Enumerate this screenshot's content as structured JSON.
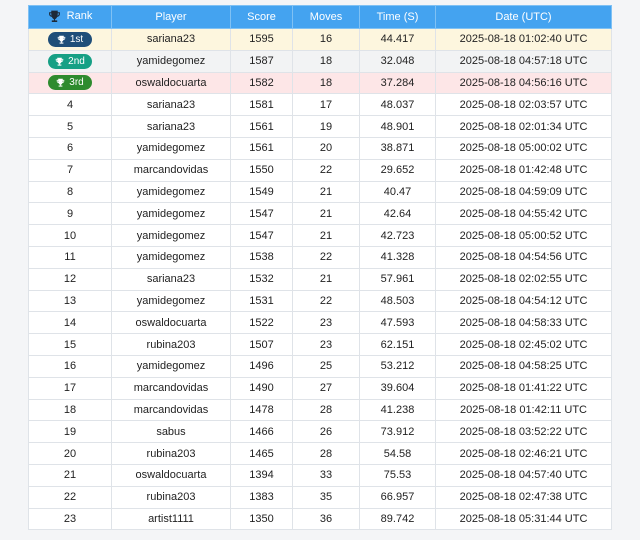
{
  "columns": {
    "rank": "Rank",
    "player": "Player",
    "score": "Score",
    "moves": "Moves",
    "time": "Time (S)",
    "date": "Date (UTC)"
  },
  "colors": {
    "header": "#44a3f0",
    "gold_badge": "#1f4e79",
    "silver_badge": "#16a085",
    "bronze_badge": "#2e8b2e"
  },
  "rows": [
    {
      "rank": "1st",
      "player": "sariana23",
      "score": "1595",
      "moves": "16",
      "time": "44.417",
      "date": "2025-08-18 01:02:40 UTC",
      "medal": "gold"
    },
    {
      "rank": "2nd",
      "player": "yamidegomez",
      "score": "1587",
      "moves": "18",
      "time": "32.048",
      "date": "2025-08-18 04:57:18 UTC",
      "medal": "silver"
    },
    {
      "rank": "3rd",
      "player": "oswaldocuarta",
      "score": "1582",
      "moves": "18",
      "time": "37.284",
      "date": "2025-08-18 04:56:16 UTC",
      "medal": "bronze"
    },
    {
      "rank": "4",
      "player": "sariana23",
      "score": "1581",
      "moves": "17",
      "time": "48.037",
      "date": "2025-08-18 02:03:57 UTC"
    },
    {
      "rank": "5",
      "player": "sariana23",
      "score": "1561",
      "moves": "19",
      "time": "48.901",
      "date": "2025-08-18 02:01:34 UTC"
    },
    {
      "rank": "6",
      "player": "yamidegomez",
      "score": "1561",
      "moves": "20",
      "time": "38.871",
      "date": "2025-08-18 05:00:02 UTC"
    },
    {
      "rank": "7",
      "player": "marcandovidas",
      "score": "1550",
      "moves": "22",
      "time": "29.652",
      "date": "2025-08-18 01:42:48 UTC"
    },
    {
      "rank": "8",
      "player": "yamidegomez",
      "score": "1549",
      "moves": "21",
      "time": "40.47",
      "date": "2025-08-18 04:59:09 UTC"
    },
    {
      "rank": "9",
      "player": "yamidegomez",
      "score": "1547",
      "moves": "21",
      "time": "42.64",
      "date": "2025-08-18 04:55:42 UTC"
    },
    {
      "rank": "10",
      "player": "yamidegomez",
      "score": "1547",
      "moves": "21",
      "time": "42.723",
      "date": "2025-08-18 05:00:52 UTC"
    },
    {
      "rank": "11",
      "player": "yamidegomez",
      "score": "1538",
      "moves": "22",
      "time": "41.328",
      "date": "2025-08-18 04:54:56 UTC"
    },
    {
      "rank": "12",
      "player": "sariana23",
      "score": "1532",
      "moves": "21",
      "time": "57.961",
      "date": "2025-08-18 02:02:55 UTC"
    },
    {
      "rank": "13",
      "player": "yamidegomez",
      "score": "1531",
      "moves": "22",
      "time": "48.503",
      "date": "2025-08-18 04:54:12 UTC"
    },
    {
      "rank": "14",
      "player": "oswaldocuarta",
      "score": "1522",
      "moves": "23",
      "time": "47.593",
      "date": "2025-08-18 04:58:33 UTC"
    },
    {
      "rank": "15",
      "player": "rubina203",
      "score": "1507",
      "moves": "23",
      "time": "62.151",
      "date": "2025-08-18 02:45:02 UTC"
    },
    {
      "rank": "16",
      "player": "yamidegomez",
      "score": "1496",
      "moves": "25",
      "time": "53.212",
      "date": "2025-08-18 04:58:25 UTC"
    },
    {
      "rank": "17",
      "player": "marcandovidas",
      "score": "1490",
      "moves": "27",
      "time": "39.604",
      "date": "2025-08-18 01:41:22 UTC"
    },
    {
      "rank": "18",
      "player": "marcandovidas",
      "score": "1478",
      "moves": "28",
      "time": "41.238",
      "date": "2025-08-18 01:42:11 UTC"
    },
    {
      "rank": "19",
      "player": "sabus",
      "score": "1466",
      "moves": "26",
      "time": "73.912",
      "date": "2025-08-18 03:52:22 UTC"
    },
    {
      "rank": "20",
      "player": "rubina203",
      "score": "1465",
      "moves": "28",
      "time": "54.58",
      "date": "2025-08-18 02:46:21 UTC"
    },
    {
      "rank": "21",
      "player": "oswaldocuarta",
      "score": "1394",
      "moves": "33",
      "time": "75.53",
      "date": "2025-08-18 04:57:40 UTC"
    },
    {
      "rank": "22",
      "player": "rubina203",
      "score": "1383",
      "moves": "35",
      "time": "66.957",
      "date": "2025-08-18 02:47:38 UTC"
    },
    {
      "rank": "23",
      "player": "artist1111",
      "score": "1350",
      "moves": "36",
      "time": "89.742",
      "date": "2025-08-18 05:31:44 UTC"
    }
  ]
}
